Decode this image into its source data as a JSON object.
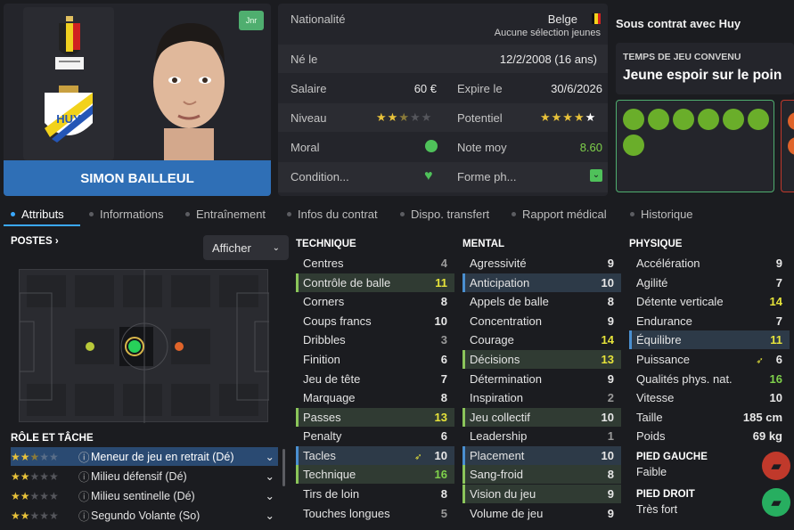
{
  "player": {
    "name": "SIMON BAILLEUL",
    "badge": "Jnr",
    "club_crest_text": "HUY"
  },
  "info": {
    "nationality_label": "Nationalité",
    "nationality_value": "Belge",
    "nationality_note": "Aucune sélection jeunes",
    "born_label": "Né le",
    "born_value": "12/2/2008 (16 ans)",
    "salary_label": "Salaire",
    "salary_value": "60 €",
    "expires_label": "Expire le",
    "expires_value": "30/6/2026",
    "level_label": "Niveau",
    "level_stars": 2.5,
    "potential_label": "Potentiel",
    "potential_stars": 5,
    "morale_label": "Moral",
    "avg_rating_label": "Note moy",
    "avg_rating_value": "8.60",
    "condition_label": "Condition...",
    "form_label": "Forme ph..."
  },
  "contract": {
    "title": "Sous contrat avec Huy",
    "playing_time_label": "TEMPS DE JEU CONVENU",
    "playing_time_value": "Jeune espoir sur le poin"
  },
  "tabs": [
    {
      "label": "Attributs",
      "active": true
    },
    {
      "label": "Informations"
    },
    {
      "label": "Entraînement"
    },
    {
      "label": "Infos du contrat"
    },
    {
      "label": "Dispo. transfert"
    },
    {
      "label": "Rapport médical"
    },
    {
      "label": "Historique"
    }
  ],
  "positions": {
    "title": "POSTES",
    "show_label": "Afficher"
  },
  "roles": {
    "title": "RÔLE ET TÂCHE",
    "items": [
      {
        "label": "Meneur de jeu en retrait (Dé)",
        "stars": 2.5,
        "selected": true
      },
      {
        "label": "Milieu défensif (Dé)",
        "stars": 2
      },
      {
        "label": "Milieu sentinelle (Dé)",
        "stars": 2
      },
      {
        "label": "Segundo Volante (So)",
        "stars": 2
      }
    ]
  },
  "technique": {
    "title": "TECHNIQUE",
    "rows": [
      {
        "label": "Centres",
        "value": "4"
      },
      {
        "label": "Contrôle de balle",
        "value": "11"
      },
      {
        "label": "Corners",
        "value": "8"
      },
      {
        "label": "Coups francs",
        "value": "10"
      },
      {
        "label": "Dribbles",
        "value": "3"
      },
      {
        "label": "Finition",
        "value": "6"
      },
      {
        "label": "Jeu de tête",
        "value": "7"
      },
      {
        "label": "Marquage",
        "value": "8"
      },
      {
        "label": "Passes",
        "value": "13"
      },
      {
        "label": "Penalty",
        "value": "6"
      },
      {
        "label": "Tacles",
        "value": "10"
      },
      {
        "label": "Technique",
        "value": "16"
      },
      {
        "label": "Tirs de loin",
        "value": "8"
      },
      {
        "label": "Touches longues",
        "value": "5"
      }
    ]
  },
  "mental": {
    "title": "MENTAL",
    "rows": [
      {
        "label": "Agressivité",
        "value": "9"
      },
      {
        "label": "Anticipation",
        "value": "10"
      },
      {
        "label": "Appels de balle",
        "value": "8"
      },
      {
        "label": "Concentration",
        "value": "9"
      },
      {
        "label": "Courage",
        "value": "14"
      },
      {
        "label": "Décisions",
        "value": "13"
      },
      {
        "label": "Détermination",
        "value": "9"
      },
      {
        "label": "Inspiration",
        "value": "2"
      },
      {
        "label": "Jeu collectif",
        "value": "10"
      },
      {
        "label": "Leadership",
        "value": "1"
      },
      {
        "label": "Placement",
        "value": "10"
      },
      {
        "label": "Sang-froid",
        "value": "8"
      },
      {
        "label": "Vision du jeu",
        "value": "9"
      },
      {
        "label": "Volume de jeu",
        "value": "9"
      }
    ]
  },
  "physique": {
    "title": "PHYSIQUE",
    "rows": [
      {
        "label": "Accélération",
        "value": "9"
      },
      {
        "label": "Agilité",
        "value": "7"
      },
      {
        "label": "Détente verticale",
        "value": "14"
      },
      {
        "label": "Endurance",
        "value": "7"
      },
      {
        "label": "Équilibre",
        "value": "11"
      },
      {
        "label": "Puissance",
        "value": "6"
      },
      {
        "label": "Qualités phys. nat.",
        "value": "16"
      },
      {
        "label": "Vitesse",
        "value": "10"
      },
      {
        "label": "Taille",
        "value": "185 cm"
      },
      {
        "label": "Poids",
        "value": "69 kg"
      }
    ],
    "left_foot_label": "PIED GAUCHE",
    "left_foot_value": "Faible",
    "right_foot_label": "PIED DROIT",
    "right_foot_value": "Très fort"
  },
  "colors": {
    "accent_blue": "#2f6fb6",
    "highlight_green": "#8bc55a",
    "highlight_blue": "#4a8fd0",
    "value_yellow": "#e6e33a",
    "value_green": "#7fd14b"
  }
}
